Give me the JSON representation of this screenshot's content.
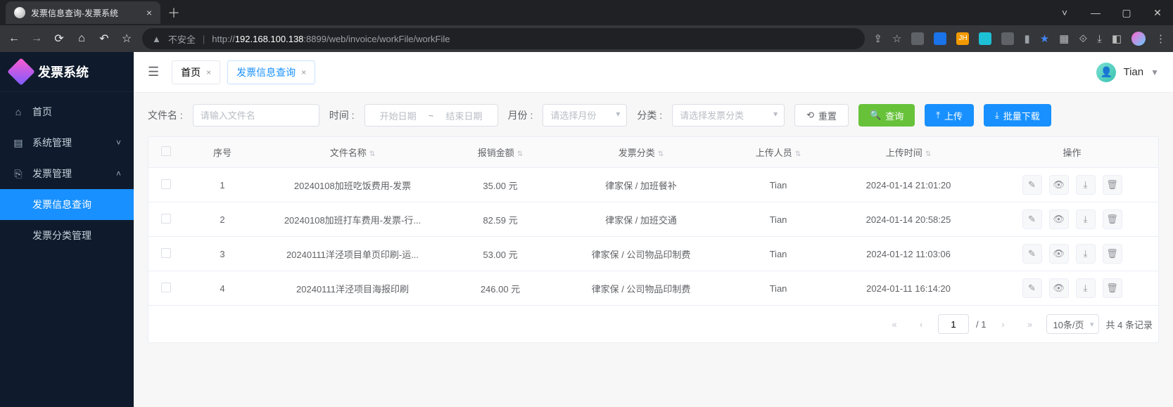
{
  "browser": {
    "tab_title": "发票信息查询-发票系统",
    "url_prefix": "http://",
    "url_host": "192.168.100.138",
    "url_rest": ":8899/web/invoice/workFile/workFile",
    "insecure_label": "不安全"
  },
  "sidebar": {
    "brand": "发票系统",
    "items": [
      {
        "icon": "⌂",
        "label": "首页"
      },
      {
        "icon": "▤",
        "label": "系统管理",
        "chevron": "˅"
      },
      {
        "icon": "⎘",
        "label": "发票管理",
        "chevron": "˄"
      }
    ],
    "subitems": [
      {
        "label": "发票信息查询",
        "active": true
      },
      {
        "label": "发票分类管理",
        "active": false
      }
    ]
  },
  "topbar": {
    "tab_home": "首页",
    "tab_active": "发票信息查询",
    "user_name": "Tian"
  },
  "filters": {
    "file_label": "文件名 :",
    "file_placeholder": "请输入文件名",
    "time_label": "时间 :",
    "date_start_placeholder": "开始日期",
    "date_end_placeholder": "结束日期",
    "month_label": "月份 :",
    "month_placeholder": "请选择月份",
    "cat_label": "分类 :",
    "cat_placeholder": "请选择发票分类",
    "reset_btn": "重置",
    "query_btn": "查询",
    "upload_btn": "上传",
    "batch_dl_btn": "批量下载"
  },
  "table": {
    "headers": [
      "",
      "序号",
      "文件名称",
      "报销金额",
      "发票分类",
      "上传人员",
      "上传时间",
      "操作"
    ],
    "currency_suffix": " 元",
    "rows": [
      {
        "seq": "1",
        "name": "20240108加班吃饭费用-发票",
        "amount": "35.00",
        "cat": "律家保 / 加班餐补",
        "uploader": "Tian",
        "time": "2024-01-14 21:01:20"
      },
      {
        "seq": "2",
        "name": "20240108加班打车费用-发票-行...",
        "amount": "82.59",
        "cat": "律家保 / 加班交通",
        "uploader": "Tian",
        "time": "2024-01-14 20:58:25"
      },
      {
        "seq": "3",
        "name": "20240111洋泾项目单页印刷-运...",
        "amount": "53.00",
        "cat": "律家保 / 公司物品印制费",
        "uploader": "Tian",
        "time": "2024-01-12 11:03:06"
      },
      {
        "seq": "4",
        "name": "20240111洋泾项目海报印刷",
        "amount": "246.00",
        "cat": "律家保 / 公司物品印制费",
        "uploader": "Tian",
        "time": "2024-01-11 16:14:20"
      }
    ]
  },
  "pager": {
    "page": "1",
    "total_pages": "/ 1",
    "page_size": "10条/页",
    "total_label": "共 4 条记录"
  }
}
